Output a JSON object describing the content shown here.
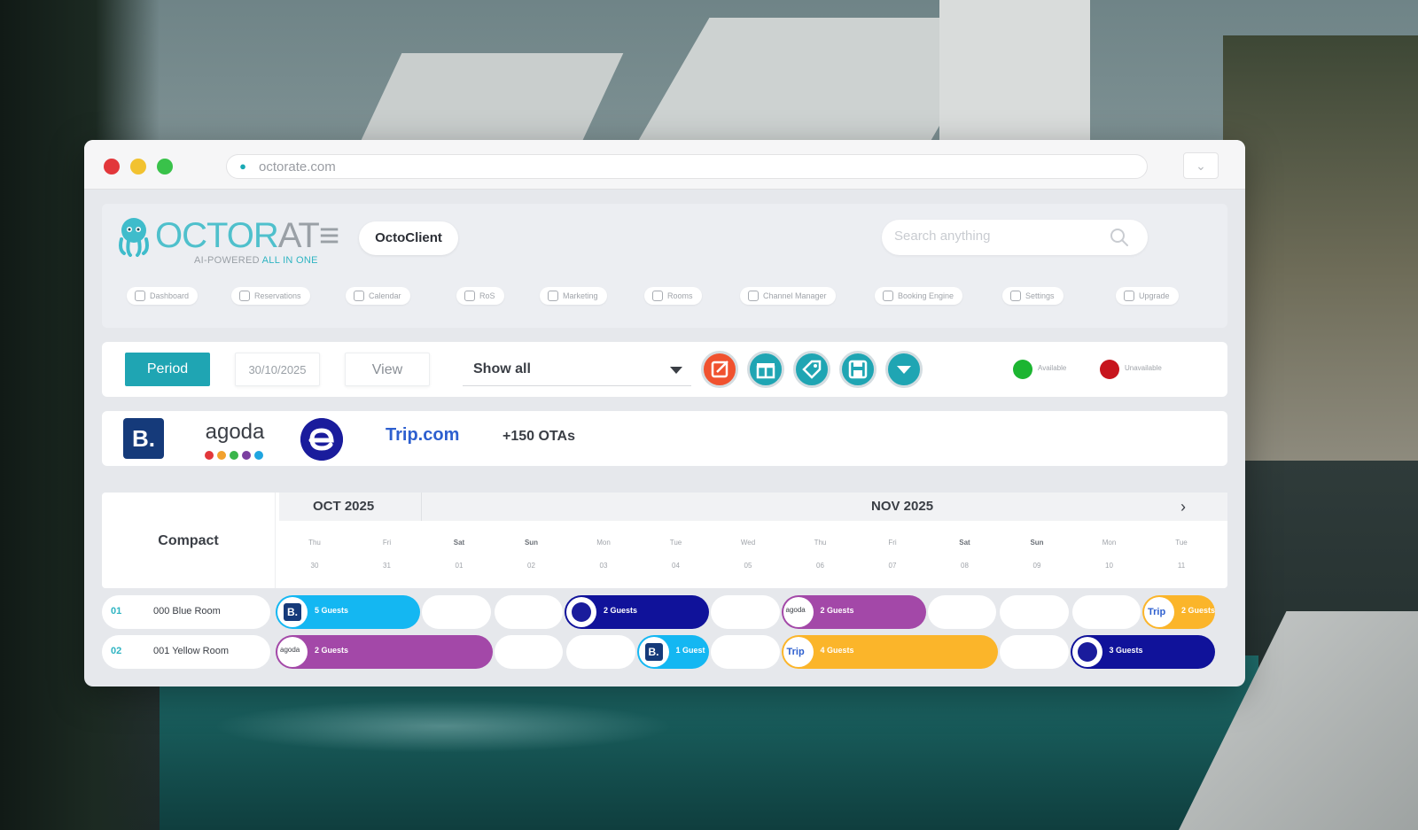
{
  "browser": {
    "url": "octorate.com"
  },
  "header": {
    "logo_word_a": "OCTOR",
    "logo_word_b": "AT≡",
    "logo_tag_a": "AI-POWERED ",
    "logo_tag_b": "ALL IN ONE",
    "client": "OctoClient",
    "search_placeholder": "Search anything",
    "nav": [
      {
        "label": "Dashboard",
        "icon": "dashboard-icon"
      },
      {
        "label": "Reservations",
        "icon": "reservations-icon"
      },
      {
        "label": "Calendar",
        "icon": "calendar-icon"
      },
      {
        "label": "RoS",
        "icon": "ros-icon"
      },
      {
        "label": "Marketing",
        "icon": "marketing-icon"
      },
      {
        "label": "Rooms",
        "icon": "rooms-icon"
      },
      {
        "label": "Channel Manager",
        "icon": "channel-manager-icon"
      },
      {
        "label": "Booking Engine",
        "icon": "booking-engine-icon"
      },
      {
        "label": "Settings",
        "icon": "settings-icon"
      },
      {
        "label": "Upgrade",
        "icon": "upgrade-icon"
      }
    ]
  },
  "toolbar": {
    "period_label": "Period",
    "date_value": "30/10/2025",
    "view_label": "View",
    "select_value": "Show all",
    "actions": [
      {
        "name": "edit-icon",
        "color": "#f0522f"
      },
      {
        "name": "gift-icon",
        "color": "#1fa5b3"
      },
      {
        "name": "tag-icon",
        "color": "#1fa5b3"
      },
      {
        "name": "save-icon",
        "color": "#1fa5b3"
      },
      {
        "name": "dropdown-icon",
        "color": "#1fa5b3"
      }
    ],
    "legend": [
      {
        "label": "Available",
        "color": "#1cb531"
      },
      {
        "label": "Unavailable",
        "color": "#c7151d"
      }
    ]
  },
  "ota": {
    "booking": "B.",
    "agoda": "agoda",
    "agoda_dot_colors": [
      "#e2373b",
      "#f2a12d",
      "#39b54a",
      "#7b3fa0",
      "#1fa5e0"
    ],
    "trip": "Trip.com",
    "more": "+150 OTAs"
  },
  "calendar": {
    "mode_label": "Compact",
    "month_a": "OCT 2025",
    "month_b": "NOV 2025",
    "days": [
      {
        "dow": "Thu",
        "date": "30",
        "weekend": false
      },
      {
        "dow": "Fri",
        "date": "31",
        "weekend": false
      },
      {
        "dow": "Sat",
        "date": "01",
        "weekend": true
      },
      {
        "dow": "Sun",
        "date": "02",
        "weekend": true
      },
      {
        "dow": "Mon",
        "date": "03",
        "weekend": false
      },
      {
        "dow": "Tue",
        "date": "04",
        "weekend": false
      },
      {
        "dow": "Wed",
        "date": "05",
        "weekend": false
      },
      {
        "dow": "Thu",
        "date": "06",
        "weekend": false
      },
      {
        "dow": "Fri",
        "date": "07",
        "weekend": false
      },
      {
        "dow": "Sat",
        "date": "08",
        "weekend": true
      },
      {
        "dow": "Sun",
        "date": "09",
        "weekend": true
      },
      {
        "dow": "Mon",
        "date": "10",
        "weekend": false
      },
      {
        "dow": "Tue",
        "date": "11",
        "weekend": false
      }
    ],
    "rooms": [
      {
        "num": "01",
        "name": "000 Blue Room",
        "bookings": [
          {
            "start": 0,
            "span": 2,
            "channel": "booking",
            "label": "5 Guests",
            "color": "#14b7f2"
          },
          {
            "start": 4,
            "span": 2,
            "channel": "expedia",
            "label": "2 Guests",
            "color": "#10129a"
          },
          {
            "start": 7,
            "span": 2,
            "channel": "agoda",
            "label": "2 Guests",
            "color": "#a348a8"
          },
          {
            "start": 12,
            "span": 1,
            "channel": "trip",
            "label": "2 Guests",
            "color": "#fbb52a"
          }
        ]
      },
      {
        "num": "02",
        "name": "001 Yellow Room",
        "bookings": [
          {
            "start": 0,
            "span": 3,
            "channel": "agoda",
            "label": "2 Guests",
            "color": "#a348a8"
          },
          {
            "start": 5,
            "span": 1,
            "channel": "booking",
            "label": "1 Guest",
            "color": "#14b7f2"
          },
          {
            "start": 7,
            "span": 3,
            "channel": "trip",
            "label": "4 Guests",
            "color": "#fbb52a"
          },
          {
            "start": 11,
            "span": 2,
            "channel": "expedia",
            "label": "3 Guests",
            "color": "#10129a"
          }
        ]
      }
    ]
  }
}
